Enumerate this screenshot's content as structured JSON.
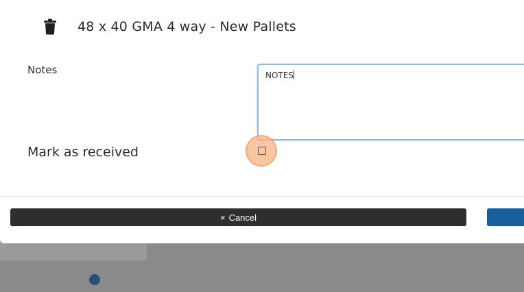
{
  "item": {
    "title": "48 x 40 GMA 4 way - New Pallets",
    "icon": "trash-icon"
  },
  "notes": {
    "label": "Notes",
    "value": "NOTES"
  },
  "received": {
    "label": "Mark as received",
    "checked": false
  },
  "footer": {
    "cancel_icon": "×",
    "cancel_label": "Cancel"
  },
  "colors": {
    "cancel_bg": "#2e2e2e",
    "confirm_bg": "#1a5e9b",
    "focus_border": "#9ab8d8",
    "highlight": "#f8b282"
  }
}
